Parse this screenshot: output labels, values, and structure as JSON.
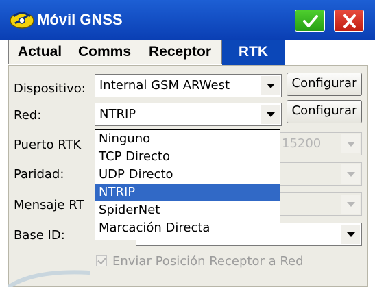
{
  "window": {
    "title": "Móvil GNSS"
  },
  "tabs": [
    {
      "label": "Actual"
    },
    {
      "label": "Comms"
    },
    {
      "label": "Receptor"
    },
    {
      "label": "RTK"
    }
  ],
  "form": {
    "dispositivo_label": "Dispositivo:",
    "dispositivo_value": "Internal GSM ARWest",
    "red_label": "Red:",
    "red_value": "NTRIP",
    "configurar_label": "Configurar",
    "puerto_label": "Puerto RTK",
    "puerto_value": "15200",
    "paridad_label": "Paridad:",
    "mensaje_label": "Mensaje RT",
    "base_label": "Base ID:",
    "checkbox_label": "Enviar Posición Receptor a Red"
  },
  "dropdown": {
    "options": [
      "Ninguno",
      "TCP Directo",
      "UDP Directo",
      "NTRIP",
      "SpiderNet",
      "Marcación Directa"
    ],
    "selected": "NTRIP"
  },
  "colors": {
    "titlebar": "#0a3fb4",
    "selection": "#3169c6",
    "ok": "#27a016",
    "close": "#c21f13"
  }
}
